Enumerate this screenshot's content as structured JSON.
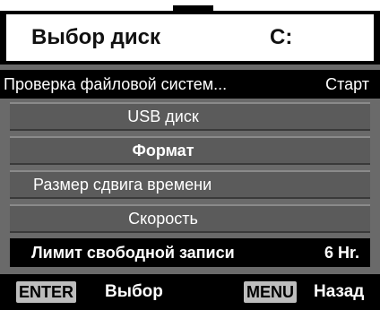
{
  "header": {
    "title": "Выбор диск",
    "drive": "C:"
  },
  "menu": {
    "items": [
      {
        "label": "Проверка файловой систем...",
        "value": "Старт"
      },
      {
        "label": "USB диск"
      },
      {
        "label": "Формат"
      },
      {
        "label": "Размер сдвига времени"
      },
      {
        "label": "Скорость"
      },
      {
        "label": "Лимит свободной записи",
        "value": "6 Hr."
      }
    ]
  },
  "footer": {
    "enter_key": "ENTER",
    "enter_label": "Выбор",
    "menu_key": "MENU",
    "menu_label": "Назад"
  },
  "colors": {
    "background": "#000000",
    "menu_gray": "#6a6a6a",
    "item_gray": "#5b5b5b",
    "key_gray": "#bdbdbd"
  }
}
